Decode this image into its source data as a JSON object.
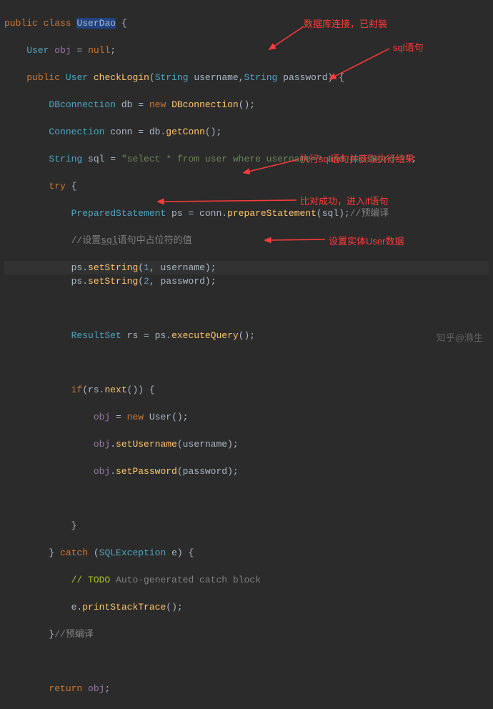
{
  "code": {
    "l1_public": "public",
    "l1_class": "class",
    "l1_name": "UserDao",
    "l1_brace": " {",
    "l2_indent": "    ",
    "l2_type": "User",
    "l2_sp": " ",
    "l2_var": "obj",
    "l2_rest": " = ",
    "l2_null": "null",
    "l2_semi": ";",
    "l3_indent": "    ",
    "l3_public": "public",
    "l3_sp": " ",
    "l3_type1": "User",
    "l3_method": "checkLogin",
    "l3_paren1": "(",
    "l3_type2": "String",
    "l3_param1": " username,",
    "l3_type3": "String",
    "l3_param2": " password) {",
    "l4_indent": "        ",
    "l4_type": "DBconnection",
    "l4_var": " db = ",
    "l4_new": "new",
    "l4_sp": " ",
    "l4_ctor": "DBconnection",
    "l4_end": "();",
    "l5_indent": "        ",
    "l5_type": "Connection",
    "l5_text": " conn = db.",
    "l5_method": "getConn",
    "l5_end": "();",
    "l6_indent": "        ",
    "l6_type": "String",
    "l6_var": " sql = ",
    "l6_str": "\"select * from user where username=? and password=?\"",
    "l6_end": ";",
    "l7_indent": "        ",
    "l7_try": "try",
    "l7_brace": " {",
    "l8_indent": "            ",
    "l8_type": "PreparedStatement",
    "l8_text": " ps = conn.",
    "l8_method": "prepareStatement",
    "l8_args": "(sql);",
    "l8_comment": "//预编译",
    "l9_indent": "            ",
    "l9_comment1": "//设置",
    "l9_comment2": "sql",
    "l9_comment3": "语句中占位符的值",
    "l10_indent": "            ",
    "l10_obj": "ps.",
    "l10_method": "setString",
    "l10_p1": "(",
    "l10_num": "1",
    "l10_p2": ", username);",
    "l11_indent": "            ",
    "l11_obj": "ps.",
    "l11_method": "setString",
    "l11_p1": "(",
    "l11_num": "2",
    "l11_p2": ", password);",
    "l13_indent": "            ",
    "l13_type": "ResultSet",
    "l13_text": " rs = ps.",
    "l13_method": "executeQuery",
    "l13_end": "();",
    "l15_indent": "            ",
    "l15_if": "if",
    "l15_cond": "(rs.",
    "l15_method": "next",
    "l15_end": "()) {",
    "l16_indent": "                ",
    "l16_var": "obj",
    "l16_eq": " = ",
    "l16_new": "new",
    "l16_sp": " ",
    "l16_type": "User",
    "l16_end": "();",
    "l17_indent": "                ",
    "l17_var": "obj",
    "l17_dot": ".",
    "l17_method": "setUsername",
    "l17_args": "(username);",
    "l18_indent": "                ",
    "l18_var": "obj",
    "l18_dot": ".",
    "l18_method": "setPassword",
    "l18_args": "(password);",
    "l20_indent": "            ",
    "l20_close": "}",
    "l21_indent": "        ",
    "l21_close": "} ",
    "l21_catch": "catch",
    "l21_paren": " (",
    "l21_type": "SQLException",
    "l21_var": " e) {",
    "l22_indent": "            ",
    "l22_todo": "// TODO",
    "l22_text": " Auto-generated catch block",
    "l23_indent": "            ",
    "l23_obj": "e.",
    "l23_method": "printStackTrace",
    "l23_end": "();",
    "l24_indent": "        ",
    "l24_close": "}",
    "l24_comment": "//预编译",
    "l26_indent": "        ",
    "l26_return": "return",
    "l26_var": " obj",
    "l26_end": ";"
  },
  "annotations": {
    "a1": "数据库连接，已封装",
    "a2": "sql语句",
    "a3": "执行sql语句并获取执行结果",
    "a4": "比对成功，进入if语句",
    "a5": "设置实体User数据"
  },
  "watermark": "知乎@滌生"
}
